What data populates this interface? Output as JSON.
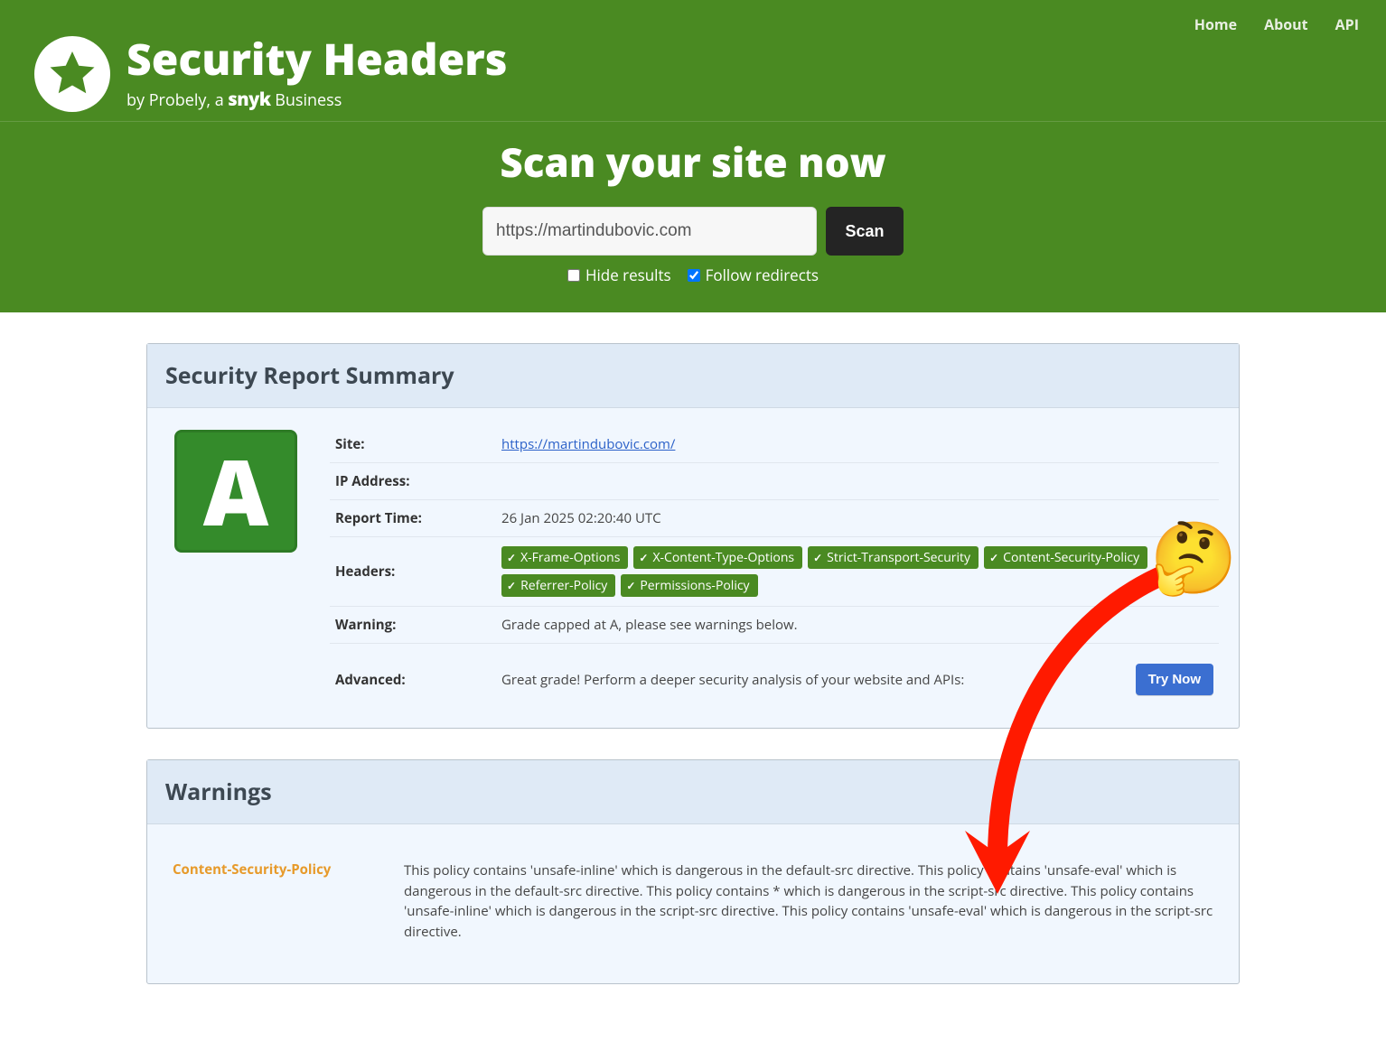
{
  "nav": {
    "home": "Home",
    "about": "About",
    "api": "API"
  },
  "brand": {
    "title": "Security Headers",
    "sub_prefix": "by Probely, a ",
    "sub_snyk": "snyk",
    "sub_suffix": " Business"
  },
  "scan": {
    "title": "Scan your site now",
    "input_value": "https://martindubovic.com",
    "button": "Scan",
    "hide_label": "Hide results",
    "follow_label": "Follow redirects",
    "hide_checked": false,
    "follow_checked": true
  },
  "summary": {
    "heading": "Security Report Summary",
    "grade": "A",
    "rows": {
      "site_label": "Site:",
      "site_value": "https://martindubovic.com/",
      "ip_label": "IP Address:",
      "ip_value": "",
      "time_label": "Report Time:",
      "time_value": "26 Jan 2025 02:20:40 UTC",
      "headers_label": "Headers:",
      "warning_label": "Warning:",
      "warning_value": "Grade capped at A, please see warnings below.",
      "advanced_label": "Advanced:",
      "advanced_value": "Great grade! Perform a deeper security analysis of your website and APIs:",
      "try_btn": "Try Now"
    },
    "headers": [
      "X-Frame-Options",
      "X-Content-Type-Options",
      "Strict-Transport-Security",
      "Content-Security-Policy",
      "Referrer-Policy",
      "Permissions-Policy"
    ]
  },
  "warnings": {
    "heading": "Warnings",
    "items": [
      {
        "name": "Content-Security-Policy",
        "text": "This policy contains 'unsafe-inline' which is dangerous in the default-src directive. This policy contains 'unsafe-eval' which is dangerous in the default-src directive. This policy contains * which is dangerous in the script-src directive. This policy contains 'unsafe-inline' which is dangerous in the script-src directive. This policy contains 'unsafe-eval' which is dangerous in the script-src directive."
      }
    ]
  },
  "annotation": {
    "emoji": "🤔"
  }
}
